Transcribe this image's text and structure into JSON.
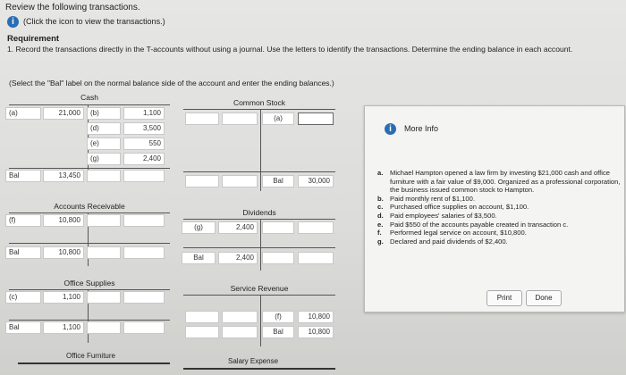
{
  "header": {
    "line1": "Review the following transactions.",
    "line2": "(Click the icon to view the transactions.)",
    "requirement_title": "Requirement",
    "requirement_text": "1. Record the transactions directly in the T-accounts without using a journal. Use the letters to identify the transactions. Determine the ending balance in each account.",
    "instruction": "(Select the \"Bal\" label on the normal balance side of the account and enter the ending balances.)"
  },
  "accounts": {
    "cash": {
      "title": "Cash",
      "debit_rows": [
        {
          "label": "(a)",
          "amount": "21,000"
        }
      ],
      "credit_rows": [
        {
          "label": "(b)",
          "amount": "1,100"
        },
        {
          "label": "(d)",
          "amount": "3,500"
        },
        {
          "label": "(e)",
          "amount": "550"
        },
        {
          "label": "(g)",
          "amount": "2,400"
        }
      ],
      "balance": {
        "label": "Bal",
        "amount": "13,450"
      }
    },
    "common_stock": {
      "title": "Common Stock",
      "credit_rows": [
        {
          "label": "(a)",
          "amount": ""
        }
      ],
      "balance": {
        "label": "Bal",
        "amount": "30,000"
      }
    },
    "accounts_receivable": {
      "title": "Accounts Receivable",
      "debit_rows": [
        {
          "label": "(f)",
          "amount": "10,800"
        }
      ],
      "balance": {
        "label": "Bal",
        "amount": "10,800"
      }
    },
    "dividends": {
      "title": "Dividends",
      "debit_rows": [
        {
          "label": "(g)",
          "amount": "2,400"
        }
      ],
      "balance": {
        "label": "Bal",
        "amount": "2,400"
      }
    },
    "office_supplies": {
      "title": "Office Supplies",
      "debit_rows": [
        {
          "label": "(c)",
          "amount": "1,100"
        }
      ],
      "balance": {
        "label": "Bal",
        "amount": "1,100"
      }
    },
    "service_revenue": {
      "title": "Service Revenue",
      "credit_rows": [
        {
          "label": "(f)",
          "amount": "10,800"
        }
      ],
      "balance": {
        "label": "Bal",
        "amount": "10,800"
      }
    },
    "office_furniture": {
      "title": "Office Furniture"
    },
    "salary_expense": {
      "title": "Salary Expense"
    }
  },
  "more_info": {
    "title": "More Info",
    "items": [
      {
        "letter": "a.",
        "text": "Michael Hampton opened a law firm by investing $21,000 cash and office furniture with a fair value of $9,000. Organized as a professional corporation, the business issued common stock to Hampton."
      },
      {
        "letter": "b.",
        "text": "Paid monthly rent of $1,100."
      },
      {
        "letter": "c.",
        "text": "Purchased office supplies on account, $1,100."
      },
      {
        "letter": "d.",
        "text": "Paid employees' salaries of $3,500."
      },
      {
        "letter": "e.",
        "text": "Paid $550 of the accounts payable created in transaction c."
      },
      {
        "letter": "f.",
        "text": "Performed legal service on account, $10,800."
      },
      {
        "letter": "g.",
        "text": "Declared and paid dividends of $2,400."
      }
    ],
    "print_label": "Print",
    "done_label": "Done"
  },
  "colors": {
    "info_icon": "#2a6db5"
  },
  "icons": {
    "info": "info-icon"
  }
}
